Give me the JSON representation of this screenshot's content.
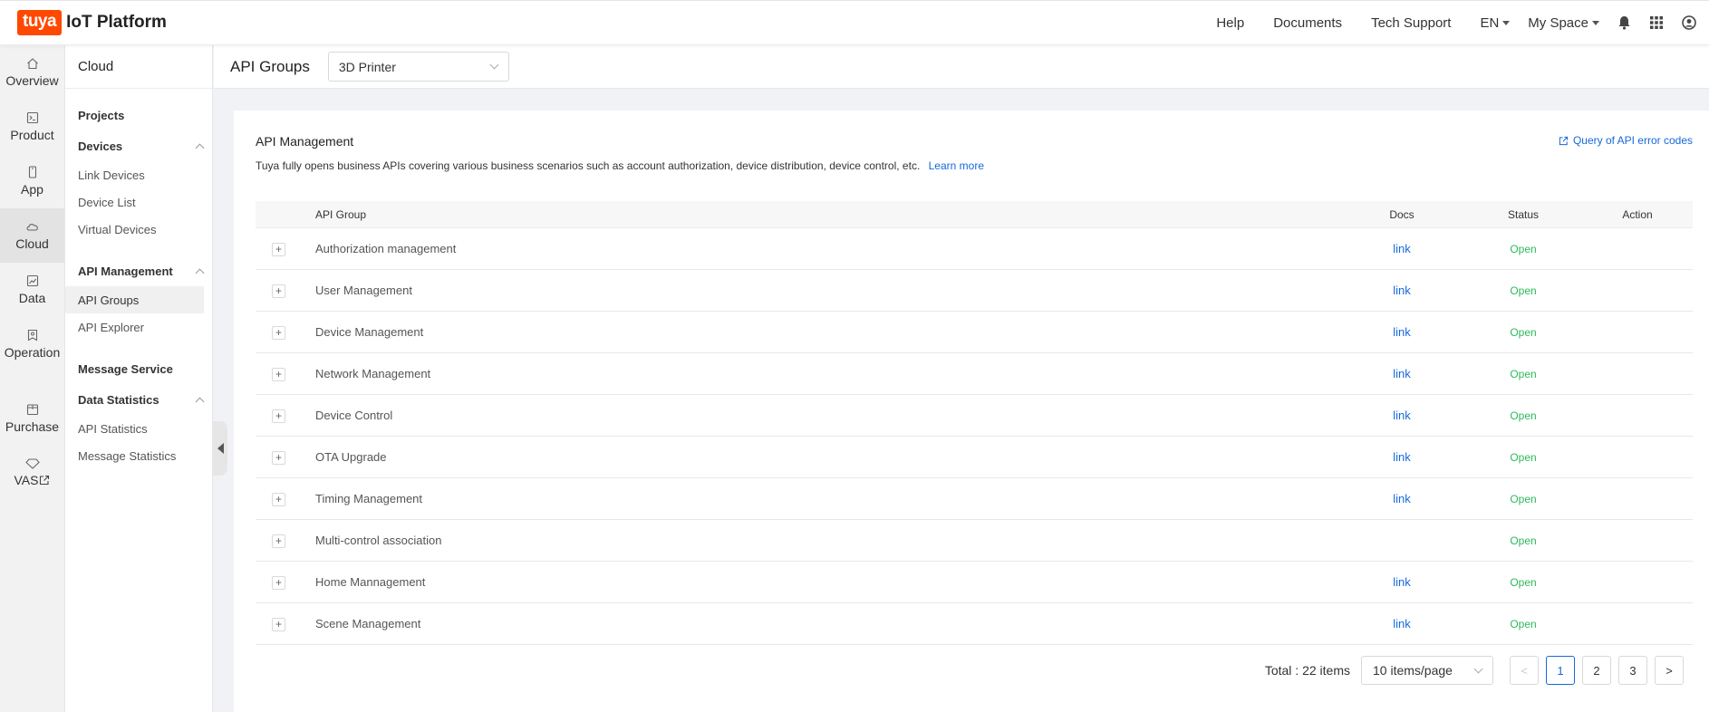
{
  "brand": {
    "badge": "tuya",
    "name": "IoT Platform",
    "color": "#ff4800"
  },
  "topnav": {
    "help": "Help",
    "documents": "Documents",
    "tech_support": "Tech Support",
    "lang": "EN",
    "space": "My Space",
    "icons": [
      "bell-icon",
      "apps-grid-icon",
      "user-avatar-icon"
    ]
  },
  "rail": [
    {
      "label": "Overview",
      "icon": "home-icon"
    },
    {
      "label": "Product",
      "icon": "terminal-icon"
    },
    {
      "label": "App",
      "icon": "phone-icon"
    },
    {
      "label": "Cloud",
      "icon": "cloud-icon",
      "active": true
    },
    {
      "label": "Data",
      "icon": "chart-icon"
    },
    {
      "label": "Operation",
      "icon": "bookmark-icon"
    },
    {
      "label": "Purchase",
      "icon": "box-icon"
    },
    {
      "label": "VAS",
      "icon": "diamond-icon"
    }
  ],
  "side": {
    "title": "Cloud",
    "projects": "Projects",
    "devices": "Devices",
    "device_links": [
      "Link Devices",
      "Device List",
      "Virtual Devices"
    ],
    "api_management": "API Management",
    "api_links": [
      "API Groups",
      "API Explorer"
    ],
    "message_service": "Message Service",
    "data_statistics": "Data Statistics",
    "stats_links": [
      "API Statistics",
      "Message Statistics"
    ]
  },
  "subhead": {
    "title": "API Groups",
    "select_value": "3D Printer"
  },
  "card": {
    "title": "API Management",
    "desc": "Tuya fully opens business APIs covering various business scenarios such as account authorization, device distribution, device control, etc.",
    "learn_more": "Learn more",
    "error_link": "Query of API error codes"
  },
  "table": {
    "headers": {
      "group": "API Group",
      "docs": "Docs",
      "status": "Status",
      "action": "Action"
    },
    "rows": [
      {
        "name": "Authorization management",
        "docs": "link",
        "status": "Open"
      },
      {
        "name": "User Management",
        "docs": "link",
        "status": "Open"
      },
      {
        "name": "Device Management",
        "docs": "link",
        "status": "Open"
      },
      {
        "name": "Network Management",
        "docs": "link",
        "status": "Open"
      },
      {
        "name": "Device Control",
        "docs": "link",
        "status": "Open"
      },
      {
        "name": "OTA Upgrade",
        "docs": "link",
        "status": "Open"
      },
      {
        "name": "Timing Management",
        "docs": "link",
        "status": "Open"
      },
      {
        "name": "Multi-control association",
        "docs": "",
        "status": "Open"
      },
      {
        "name": "Home Mannagement",
        "docs": "link",
        "status": "Open"
      },
      {
        "name": "Scene Management",
        "docs": "link",
        "status": "Open"
      }
    ],
    "expand_symbol": "+"
  },
  "pager": {
    "total": "Total : 22 items",
    "size": "10 items/page",
    "prev": "<",
    "next": ">",
    "pages": [
      "1",
      "2",
      "3"
    ],
    "current": "1"
  },
  "colors": {
    "link": "#1668dc",
    "open": "#2eb85c",
    "brand": "#ff4800"
  }
}
